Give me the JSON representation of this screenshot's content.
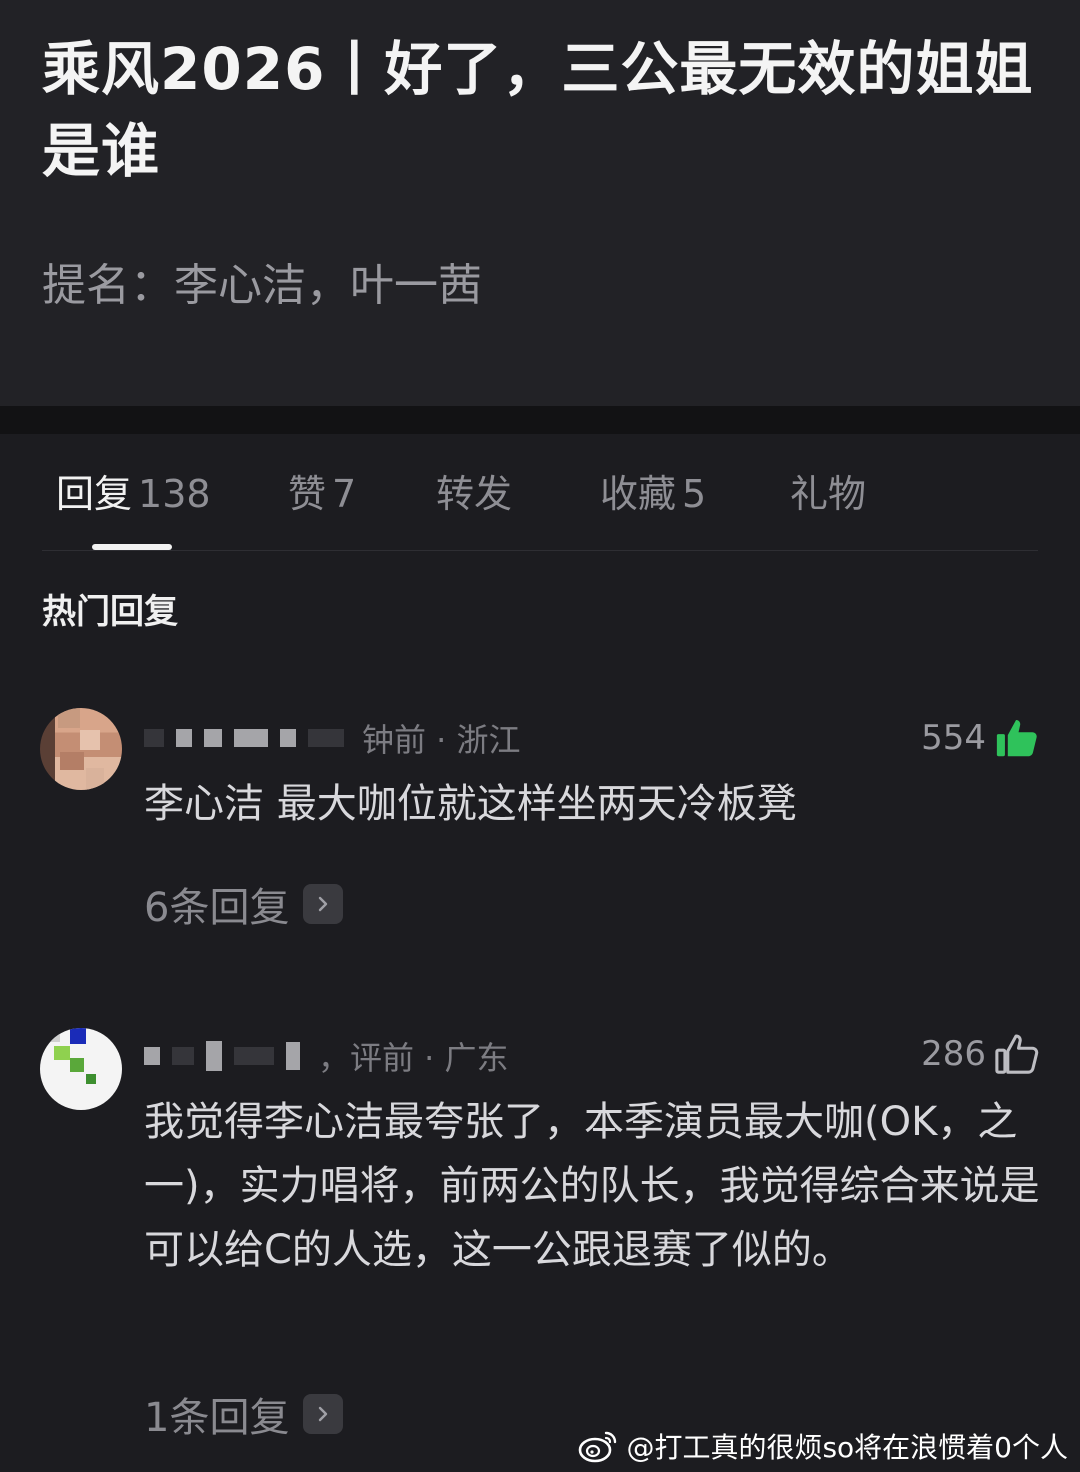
{
  "post": {
    "title": "乘风2026丨好了，三公最无效的姐姐是谁",
    "body": "提名：李心洁，叶一茜"
  },
  "tabs": [
    {
      "label": "回复",
      "count": "138"
    },
    {
      "label": "赞",
      "count": "7"
    },
    {
      "label": "转发",
      "count": ""
    },
    {
      "label": "收藏",
      "count": "5"
    },
    {
      "label": "礼物",
      "count": ""
    }
  ],
  "section_title": "热门回复",
  "comments": [
    {
      "meta": "钟前 · 浙江",
      "likes": "554",
      "liked": true,
      "text": "李心洁 最大咖位就这样坐两天冷板凳",
      "replies": "6条回复"
    },
    {
      "meta": "，评前 · 广东",
      "likes": "286",
      "liked": false,
      "text": "我觉得李心洁最夸张了，本季演员最大咖(OK，之一)，实力唱将，前两公的队长，我觉得综合来说是可以给C的人选，这一公跟退赛了似的。",
      "replies": "1条回复"
    }
  ],
  "watermark": "@打工真的很烦so将在浪惯着0个人",
  "colors": {
    "background": "#1c1c20",
    "post_background": "#222226",
    "liked_green": "#2fc25b"
  },
  "icons": {
    "like_filled": "thumb-up-filled-icon",
    "like_outline": "thumb-up-outline-icon",
    "chevron": "chevron-right-icon",
    "watermark_logo": "weibo-logo-icon"
  }
}
